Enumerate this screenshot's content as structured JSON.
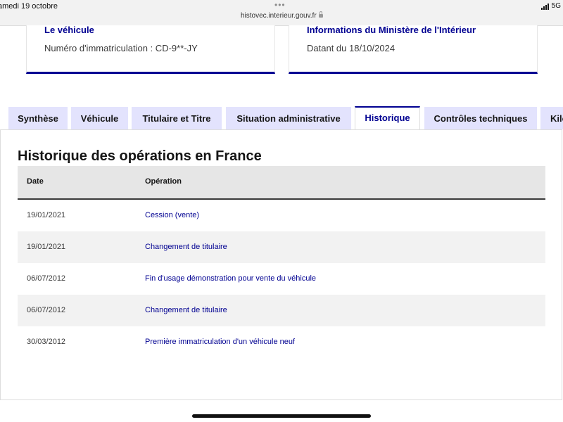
{
  "statusbar": {
    "date": "amedi 19 octobre",
    "dots": "•••",
    "url": "histovec.interieur.gouv.fr",
    "network": "5G"
  },
  "cards": {
    "vehicule": {
      "title": "Le véhicule",
      "text": "Numéro d'immatriculation : CD-9**-JY"
    },
    "infos": {
      "title": "Informations du Ministère de l'Intérieur",
      "text": "Datant du 18/10/2024"
    }
  },
  "tabs": [
    {
      "label": "Synthèse"
    },
    {
      "label": "Véhicule"
    },
    {
      "label": "Titulaire et Titre"
    },
    {
      "label": "Situation administrative"
    },
    {
      "label": "Historique",
      "active": true
    },
    {
      "label": "Contrôles techniques"
    },
    {
      "label": "Kilo"
    }
  ],
  "section": {
    "title": "Historique des opérations en France"
  },
  "table": {
    "headers": {
      "date": "Date",
      "operation": "Opération"
    },
    "rows": [
      {
        "date": "19/01/2021",
        "operation": "Cession (vente)"
      },
      {
        "date": "19/01/2021",
        "operation": "Changement de titulaire"
      },
      {
        "date": "06/07/2012",
        "operation": "Fin d'usage démonstration pour vente du véhicule"
      },
      {
        "date": "06/07/2012",
        "operation": "Changement de titulaire"
      },
      {
        "date": "30/03/2012",
        "operation": "Première immatriculation d'un véhicule neuf"
      }
    ]
  },
  "colors": {
    "primary": "#000091",
    "tab_background": "#e3e3fd",
    "header_background": "#e6e6e6",
    "row_alt": "#f2f2f2"
  }
}
